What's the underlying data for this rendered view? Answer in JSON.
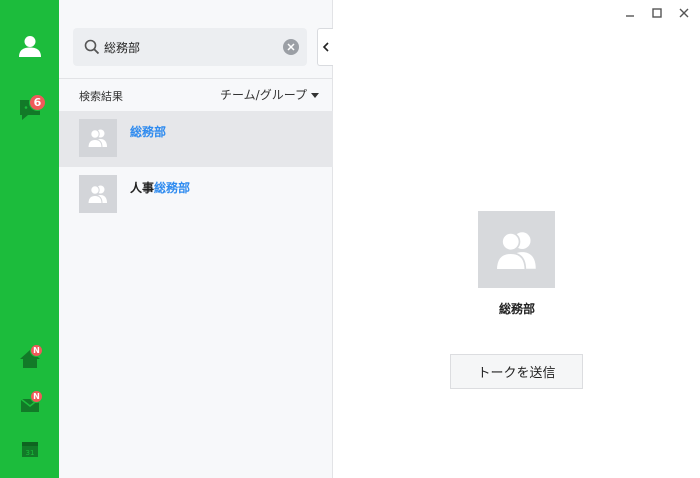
{
  "app": {
    "accent_color": "#1cbc3c",
    "badge_color": "#ef5a5a",
    "highlight_color": "#2f8bef"
  },
  "rail": {
    "profile": {
      "icon": "person-icon"
    },
    "chats": {
      "icon": "chat-bubble-icon",
      "badge": "6"
    },
    "home": {
      "icon": "home-icon",
      "badge": "N"
    },
    "mail": {
      "icon": "mail-icon",
      "badge": "N"
    },
    "calendar": {
      "icon": "calendar-icon",
      "day": "31"
    }
  },
  "search": {
    "value": "総務部",
    "icon": "search-icon",
    "clear_icon": "clear-icon"
  },
  "collapse": {
    "icon": "chevron-left-icon"
  },
  "results": {
    "label": "検索結果",
    "filter_label": "チーム/グループ",
    "items": [
      {
        "prefix": "",
        "match": "総務部",
        "selected": true
      },
      {
        "prefix": "人事",
        "match": "総務部",
        "selected": false
      }
    ]
  },
  "window": {
    "minimize_icon": "minimize-icon",
    "maximize_icon": "maximize-icon",
    "close_icon": "close-icon"
  },
  "profile": {
    "name": "総務部",
    "send_label": "トークを送信"
  }
}
